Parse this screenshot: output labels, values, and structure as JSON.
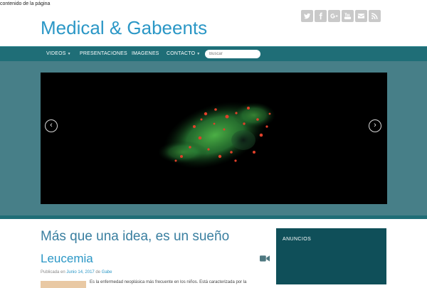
{
  "skip_link": "contenido de la página",
  "site": {
    "title": "Medical & Gabeents"
  },
  "social": [
    {
      "icon": "twitter-icon",
      "label": "Twitter"
    },
    {
      "icon": "facebook-icon",
      "label": "Facebook"
    },
    {
      "icon": "google-plus-icon",
      "label": "Google+"
    },
    {
      "icon": "youtube-icon",
      "label": "YouTube"
    },
    {
      "icon": "email-icon",
      "label": "Email"
    },
    {
      "icon": "rss-icon",
      "label": "RSS"
    }
  ],
  "nav": {
    "items": [
      {
        "label": "VIDEOS",
        "dropdown": true
      },
      {
        "label": "PRESENTACIONES",
        "dropdown": false
      },
      {
        "label": "IMAGENES",
        "dropdown": false
      },
      {
        "label": "CONTACTO",
        "dropdown": true
      }
    ],
    "search_placeholder": "Buscar"
  },
  "slider": {
    "prev_icon": "chevron-left-icon",
    "next_icon": "chevron-right-icon"
  },
  "main": {
    "heading": "Más que una idea, es un sueño",
    "post": {
      "title": "Leucemia",
      "meta_prefix": "Publicada en",
      "date": "Junio 14, 2017",
      "by": "de",
      "author": "Gabe",
      "excerpt": "Es la enfermedad neoplásica más frecuente en los niños. Está caracterizada por la"
    }
  },
  "sidebar": {
    "title": "ANUNCIOS"
  },
  "colors": {
    "accent": "#2b97c6",
    "nav": "#1f6e77",
    "band": "#477f88",
    "sidebar": "#0f4f59"
  }
}
